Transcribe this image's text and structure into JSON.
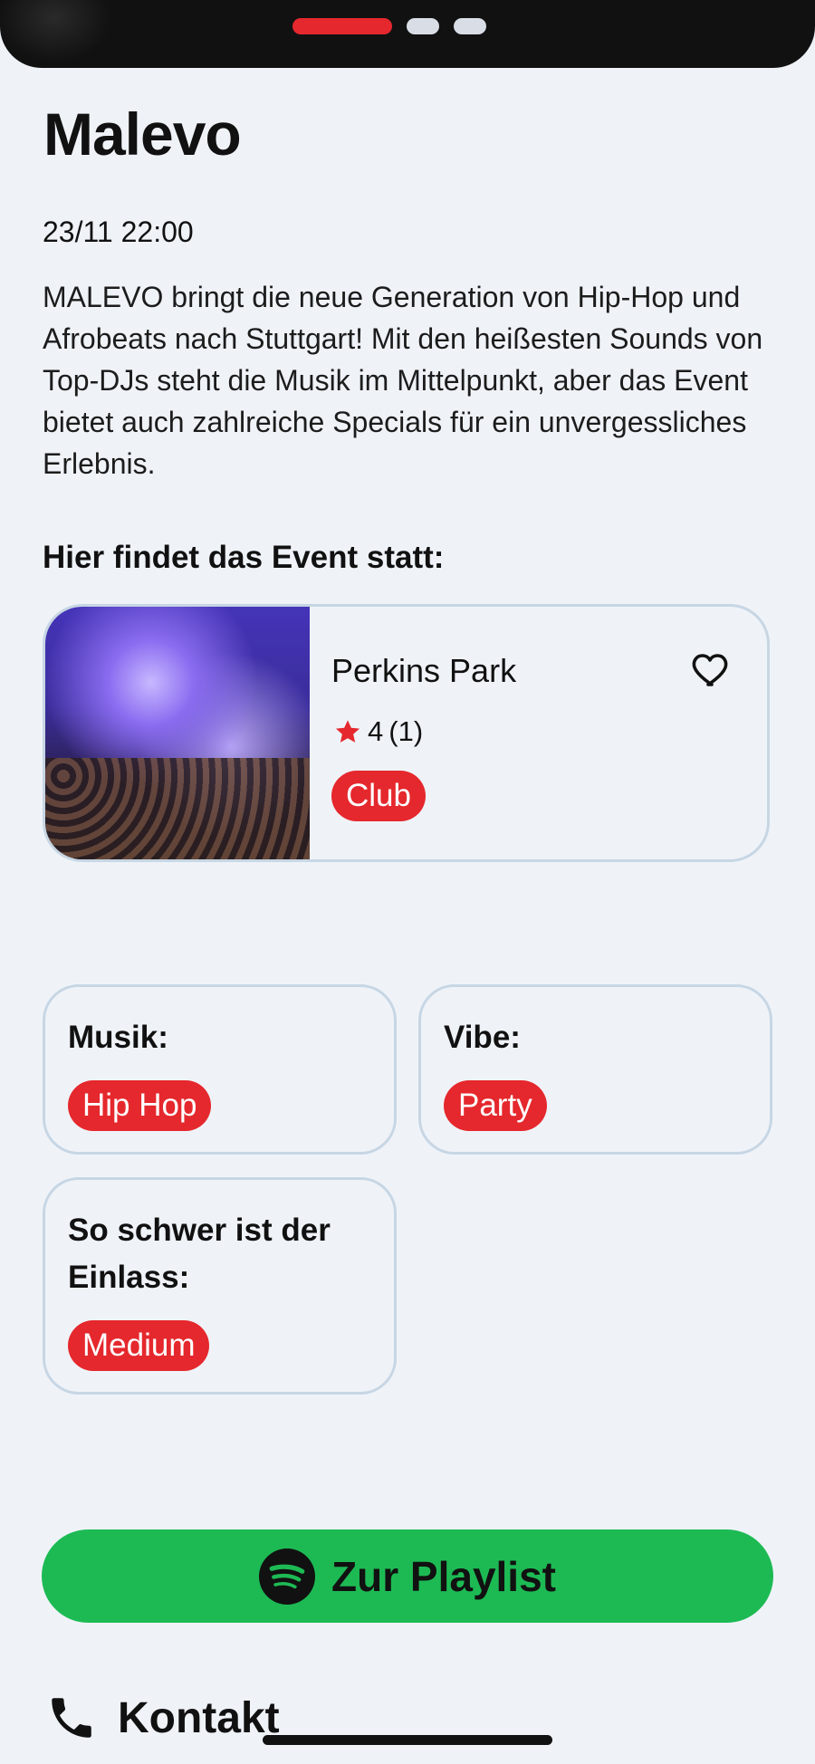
{
  "event": {
    "title": "Malevo",
    "datetime": "23/11 22:00",
    "description": "MALEVO bringt die neue Generation von Hip-Hop und Afrobeats nach Stuttgart! Mit den heißesten Sounds von Top-DJs steht die Musik im Mittelpunkt, aber das Event bietet auch zahlreiche Specials für ein unvergessliches Erlebnis."
  },
  "carousel": {
    "active_index": 0,
    "count": 3
  },
  "venue": {
    "heading": "Hier findet das Event statt:",
    "name": "Perkins Park",
    "rating": "4",
    "rating_count": "(1)",
    "tag": "Club"
  },
  "attributes": {
    "music_label": "Musik:",
    "music_value": "Hip Hop",
    "vibe_label": "Vibe:",
    "vibe_value": "Party",
    "entry_label": "So schwer ist der Einlass:",
    "entry_value": "Medium"
  },
  "actions": {
    "playlist_label": "Zur Playlist",
    "contact_label": "Kontakt"
  },
  "colors": {
    "accent_red": "#e5282d",
    "spotify_green": "#1dba54",
    "background": "#eff3f8",
    "card_border": "#c7d6e4"
  },
  "icons": [
    "heart-icon",
    "star-icon",
    "spotify-icon",
    "phone-icon"
  ]
}
